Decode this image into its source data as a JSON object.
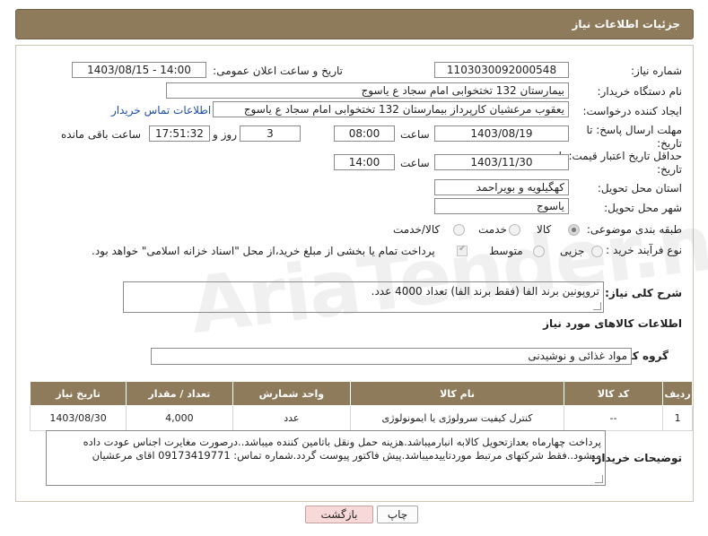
{
  "header": {
    "title": "جزئیات اطلاعات نیاز"
  },
  "fields": {
    "need_number_label": "شماره نیاز:",
    "need_number": "1103030092000548",
    "announce_label": "تاریخ و ساعت اعلان عمومی:",
    "announce_value": "1403/08/15 - 14:00",
    "buyer_org_label": "نام دستگاه خریدار:",
    "buyer_org": "بیمارستان 132 تختخوابی امام سجاد  ع  یاسوج",
    "requester_label": "ایجاد کننده درخواست:",
    "requester": "یعقوب مرعشیان کارپرداز بیمارستان 132 تختخوابی امام سجاد  ع  یاسوج",
    "contact_link": "اطلاعات تماس خریدار",
    "deadline_label": "مهلت ارسال پاسخ: تا",
    "deadline_label2": "تاریخ:",
    "deadline_date": "1403/08/19",
    "time_label": "ساعت",
    "deadline_time": "08:00",
    "days_value": "3",
    "days_label": "روز و",
    "remaining_time": "17:51:32",
    "remaining_label": "ساعت باقی مانده",
    "validity_label": "حداقل تاریخ اعتبار قیمت: تا",
    "validity_label2": "تاریخ:",
    "validity_date": "1403/11/30",
    "validity_time": "14:00",
    "province_label": "استان محل تحویل:",
    "province": "کهگیلویه و بویراحمد",
    "city_label": "شهر محل تحویل:",
    "city": "یاسوج",
    "category_label": "طبقه بندی موضوعی:",
    "category_options": [
      "کالا",
      "خدمت",
      "کالا/خدمت"
    ],
    "process_label": "نوع فرآیند خرید :",
    "process_options": [
      "جزیی",
      "متوسط"
    ],
    "payment_note": "پرداخت تمام یا بخشی از مبلغ خرید،از محل \"اسناد خزانه اسلامی\" خواهد بود.",
    "description_label": "شرح کلی نیاز:",
    "description": "تروپونین برند الفا (فقط برند الفا) تعداد 4000 عدد.",
    "goods_info_title": "اطلاعات کالاهای مورد نیاز",
    "goods_group_label": "گروه کالا:",
    "goods_group": "مواد غذائی و نوشیدنی"
  },
  "table": {
    "headers": [
      "ردیف",
      "کد کالا",
      "نام کالا",
      "واحد شمارش",
      "تعداد / مقدار",
      "تاریخ نیاز"
    ],
    "rows": [
      [
        "1",
        "--",
        "کنترل کیفیت سرولوژی یا ایمونولوژی",
        "عدد",
        "4,000",
        "1403/08/30"
      ]
    ]
  },
  "buyer_notes": {
    "label": "توضیحات خریدار:",
    "line1": "پرداخت چهارماه بعدازتحویل کالابه انبارمیباشد.هزینه حمل ونقل باتامین کننده میباشد..درصورت مغایرت اجناس عودت داده",
    "line2": "میشود..فقط شرکتهای مرتبط موردتاییدمیباشد.پیش فاکتور پیوست گردد.شماره تماس: 09173419771  اقای مرعشیان"
  },
  "buttons": {
    "print": "چاپ",
    "back": "بازگشت"
  },
  "watermark": "AriaTender.neT",
  "colors": {
    "header": "#8e7b5b",
    "back_button_bg": "#f8d9d9",
    "link": "#1f4ea8"
  }
}
